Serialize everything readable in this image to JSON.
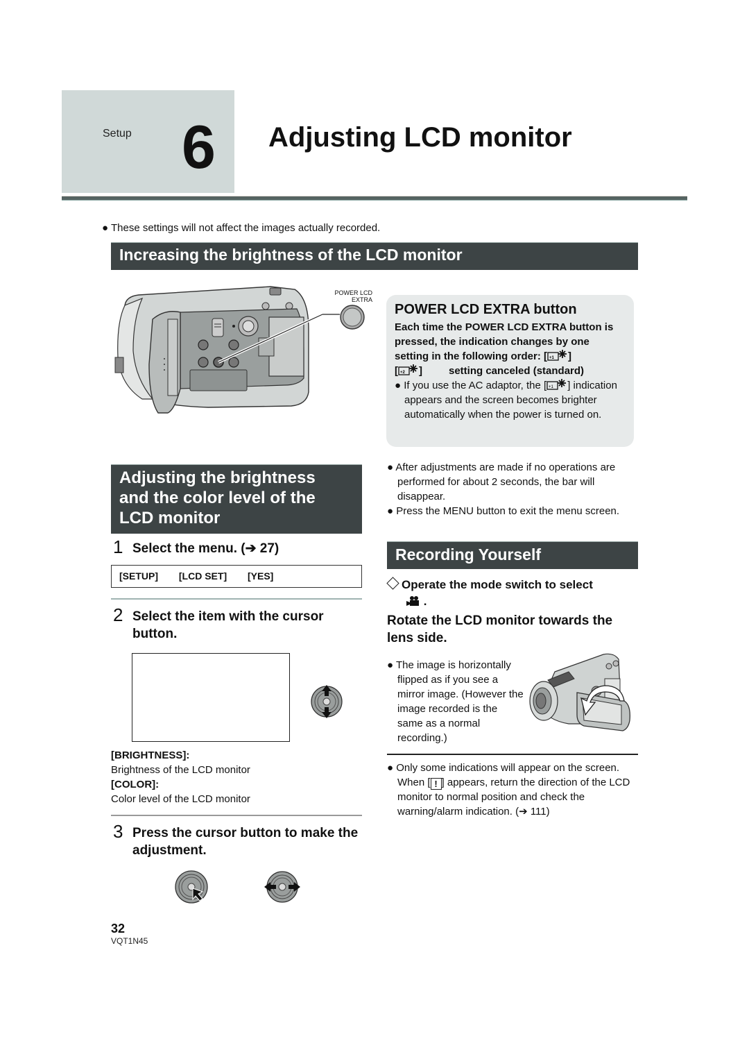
{
  "header": {
    "section": "Setup",
    "chapter_number": "6",
    "title": "Adjusting LCD monitor"
  },
  "intro_note": "These settings will not affect the images actually recorded.",
  "section_increase": {
    "heading": "Increasing the brightness of the LCD monitor",
    "illustration_label_line1": "POWER LCD",
    "illustration_label_line2": "EXTRA",
    "infobox": {
      "title": "POWER LCD EXTRA button",
      "bold_line_1": "Each time the POWER LCD EXTRA button is pressed, the indication changes by one setting in the following order: [",
      "bold_close_1": "]",
      "bold_open_2": "[",
      "bold_close_2": "]",
      "bold_line_2": "setting canceled (standard)",
      "bullet_part_1": "If you use the AC adaptor, the [",
      "bullet_part_2": "] indication appears and the screen becomes brighter automatically when the power is turned on.",
      "icon_plus1_label": "+1",
      "icon_plus2_label": "+2"
    }
  },
  "section_adjust": {
    "heading_line1": "Adjusting the brightness",
    "heading_line2": "and the color level of the",
    "heading_line3": "LCD monitor",
    "step1": {
      "number": "1",
      "text": "Select the menu. (➔ 27)"
    },
    "menu_path": [
      "[SETUP]",
      "[LCD SET]",
      "[YES]"
    ],
    "step2": {
      "number": "2",
      "text": "Select the item with the cursor button."
    },
    "items": [
      {
        "term": "[BRIGHTNESS]:",
        "desc": "Brightness of the LCD monitor"
      },
      {
        "term": "[COLOR]:",
        "desc": "Color level of the LCD monitor"
      }
    ],
    "step3": {
      "number": "3",
      "text": "Press the cursor button to make the adjustment."
    },
    "notes": [
      "After adjustments are made if no operations are performed for about 2 seconds, the bar will disappear.",
      "Press the MENU button to exit the menu screen."
    ]
  },
  "section_recording": {
    "heading": "Recording Yourself",
    "operate_text": "Operate the mode switch to select",
    "operate_suffix": ".",
    "rotate_text": "Rotate the LCD monitor towards the lens side.",
    "mirror_note": "The image is horizontally flipped as if you see a mirror image. (However the image recorded is the same as a normal recording.)",
    "indication_note_part1": "Only some indications will appear on the screen. When [",
    "warning_glyph": "!",
    "indication_note_part2": "] appears, return the direction of the LCD monitor to normal position and check the warning/alarm indication. (➔ 111)"
  },
  "footer": {
    "page_number": "32",
    "doc_code": "VQT1N45"
  }
}
